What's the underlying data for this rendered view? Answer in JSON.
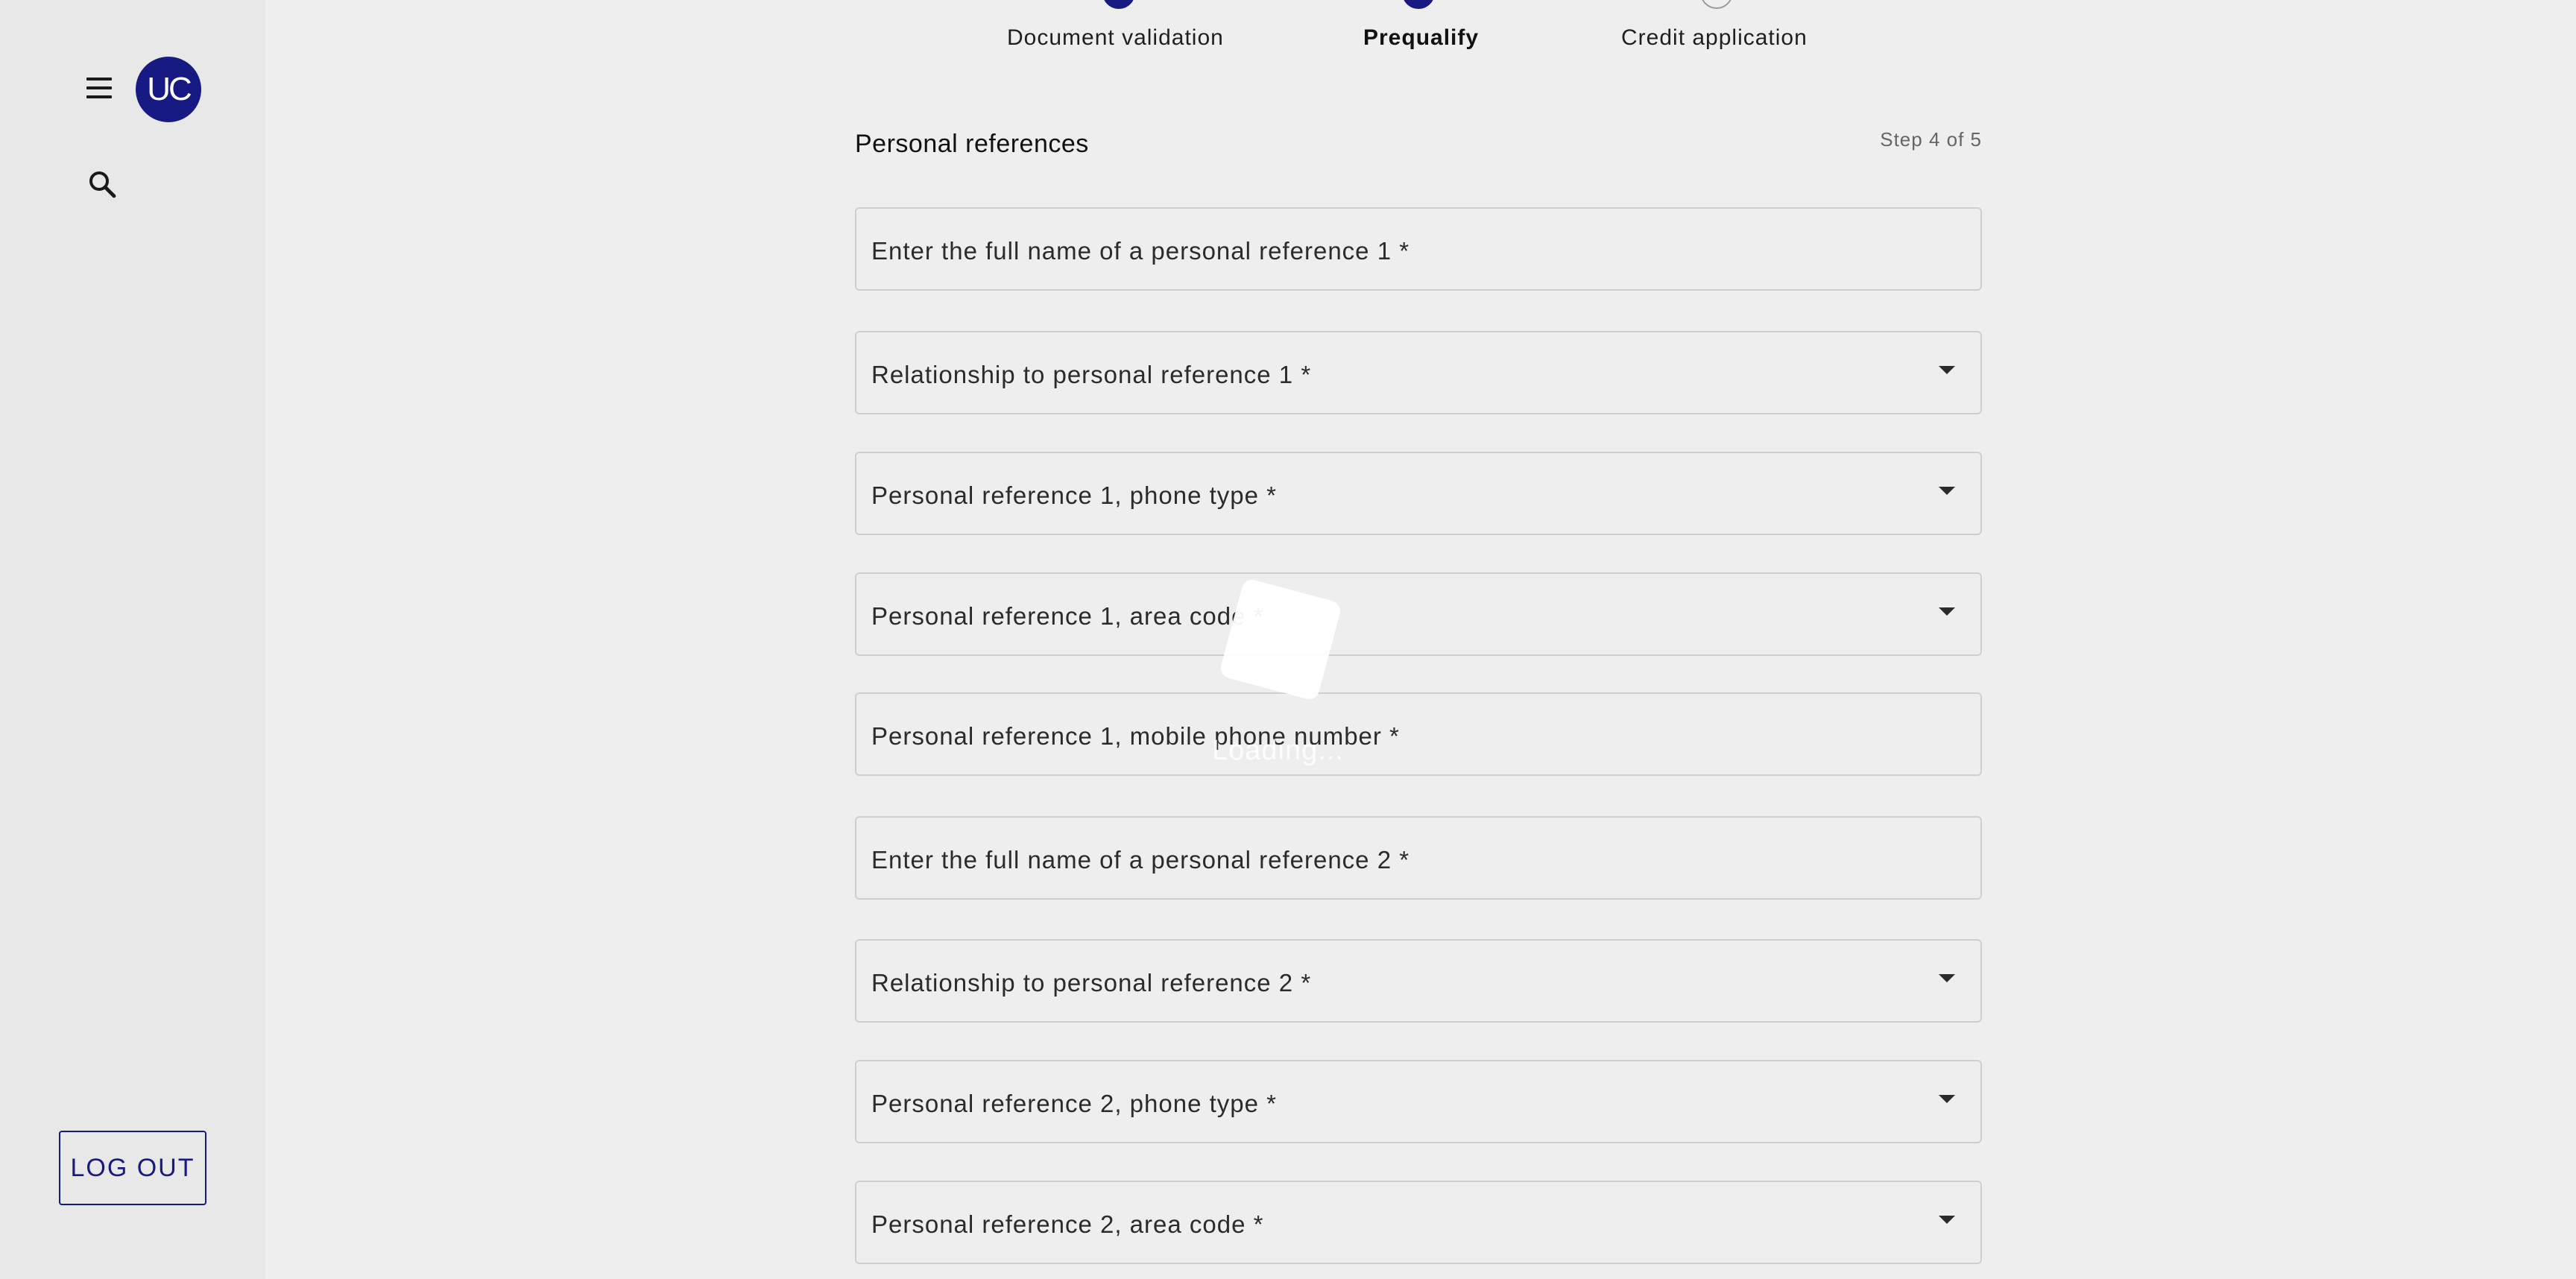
{
  "sidebar": {
    "avatar_initials": "UC",
    "menu_icon": "hamburger-menu-icon",
    "search_icon": "search-icon",
    "logout_label": "LOG OUT"
  },
  "stepper": {
    "steps": [
      {
        "label": "Document validation",
        "state": "completed"
      },
      {
        "label": "Prequalify",
        "state": "active"
      },
      {
        "label": "Credit application",
        "state": "upcoming"
      }
    ]
  },
  "form": {
    "section_title": "Personal references",
    "step_indicator": "Step 4 of 5",
    "fields": [
      {
        "label": "Enter the full name of a personal reference 1 *",
        "type": "text"
      },
      {
        "label": "Relationship to personal reference 1 *",
        "type": "select"
      },
      {
        "label": "Personal reference 1, phone type *",
        "type": "select"
      },
      {
        "label": "Personal reference 1, area code *",
        "type": "select"
      },
      {
        "label": "Personal reference 1, mobile phone number *",
        "type": "text"
      },
      {
        "label": "Enter the full name of a personal reference 2 *",
        "type": "text"
      },
      {
        "label": "Relationship to personal reference 2 *",
        "type": "select"
      },
      {
        "label": "Personal reference 2, phone type *",
        "type": "select"
      },
      {
        "label": "Personal reference 2, area code *",
        "type": "select"
      }
    ]
  },
  "loading": {
    "text": "Loading..."
  },
  "colors": {
    "primary": "#171a82",
    "background": "#eeeeee",
    "sidebar_background": "#e8e8e8",
    "field_border": "#cfcfcf"
  }
}
